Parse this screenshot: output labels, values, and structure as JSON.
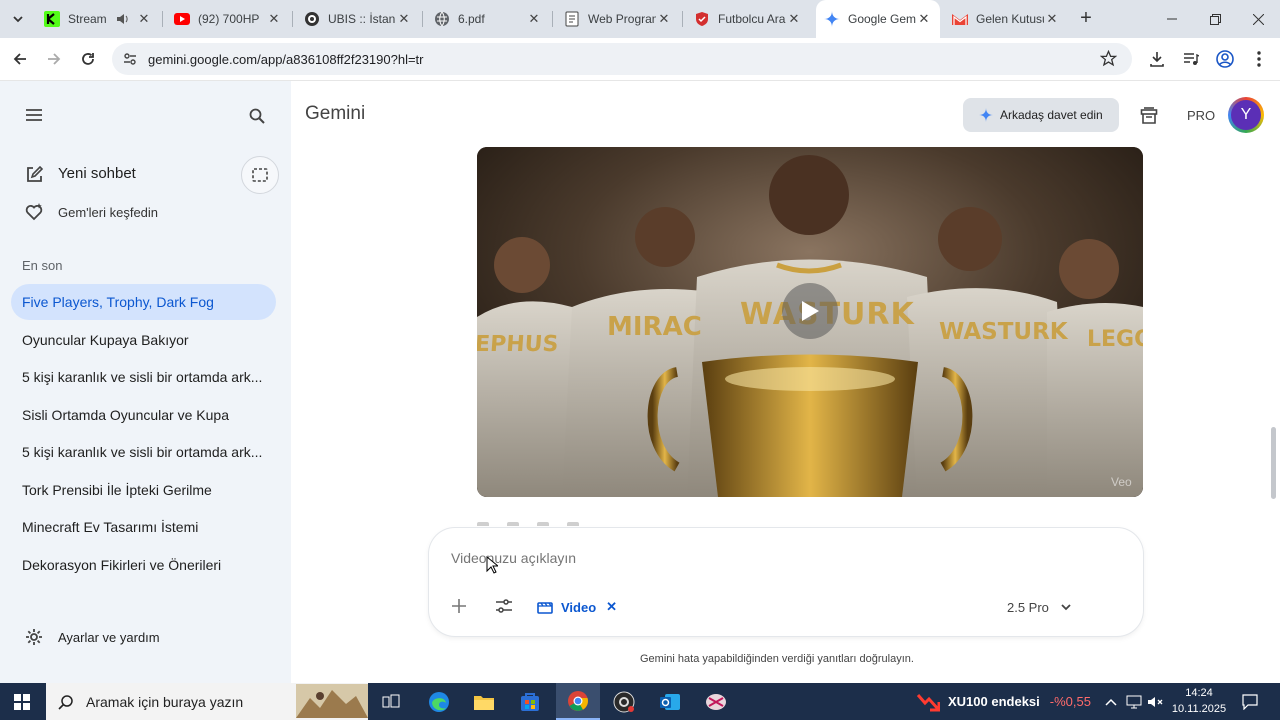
{
  "browser": {
    "tabs": [
      {
        "title": "Stream",
        "favicon": "kick-icon",
        "active": false
      },
      {
        "title": "(92) 700HP",
        "favicon": "youtube-icon",
        "active": false
      },
      {
        "title": "UBIS :: İstanbul",
        "favicon": "ubis-icon",
        "active": false
      },
      {
        "title": "6.pdf",
        "favicon": "globe-icon",
        "active": false
      },
      {
        "title": "Web Programlama",
        "favicon": "doc-icon",
        "active": false
      },
      {
        "title": "Futbolcu Arama",
        "favicon": "shield-icon",
        "active": false
      },
      {
        "title": "Google Gemini",
        "favicon": "gemini-icon",
        "active": true
      },
      {
        "title": "Gelen Kutusu",
        "favicon": "gmail-icon",
        "active": false
      }
    ],
    "url": "gemini.google.com/app/a836108ff2f23190?hl=tr"
  },
  "app": {
    "title": "Gemini",
    "invite_label": "Arkadaş davet edin",
    "plan_badge": "PRO",
    "avatar_letter": "Y"
  },
  "sidebar": {
    "new_chat": "Yeni sohbet",
    "explore_gems": "Gem'leri keşfedin",
    "recent_header": "En son",
    "chats": [
      "Five Players, Trophy, Dark Fog",
      "Oyuncular Kupaya Bakıyor",
      "5 kişi karanlık ve sisli bir ortamda ark...",
      "Sisli Ortamda Oyuncular ve Kupa",
      "5 kişi karanlık ve sisli bir ortamda ark...",
      "Tork Prensibi İle İpteki Gerilme",
      "Minecraft Ev Tasarımı İstemi",
      "Dekorasyon Fikirleri ve Önerileri"
    ],
    "settings": "Ayarlar ve yardım"
  },
  "video": {
    "jersey_names": [
      "EPHUS",
      "MIRAC",
      "WASTURK",
      "WASTURK",
      "LEGOO"
    ],
    "watermark": "Veo"
  },
  "composer": {
    "placeholder": "Videonuzu açıklayın",
    "tool_chip": "Video",
    "model": "2.5 Pro"
  },
  "disclaimer": "Gemini hata yapabildiğinden verdiği yanıtları doğrulayın.",
  "taskbar": {
    "search_placeholder": "Aramak için buraya yazın",
    "ticker_name": "XU100 endeksi",
    "ticker_value": "-%0,55",
    "time": "14:24",
    "date": "10.11.2025"
  },
  "colors": {
    "accent": "#0b57d0",
    "sidebar_bg": "#f0f4f9",
    "active_chat_bg": "#d3e3fd",
    "taskbar_bg": "#1c2e4a",
    "ticker_negative": "#ff6b6b"
  }
}
